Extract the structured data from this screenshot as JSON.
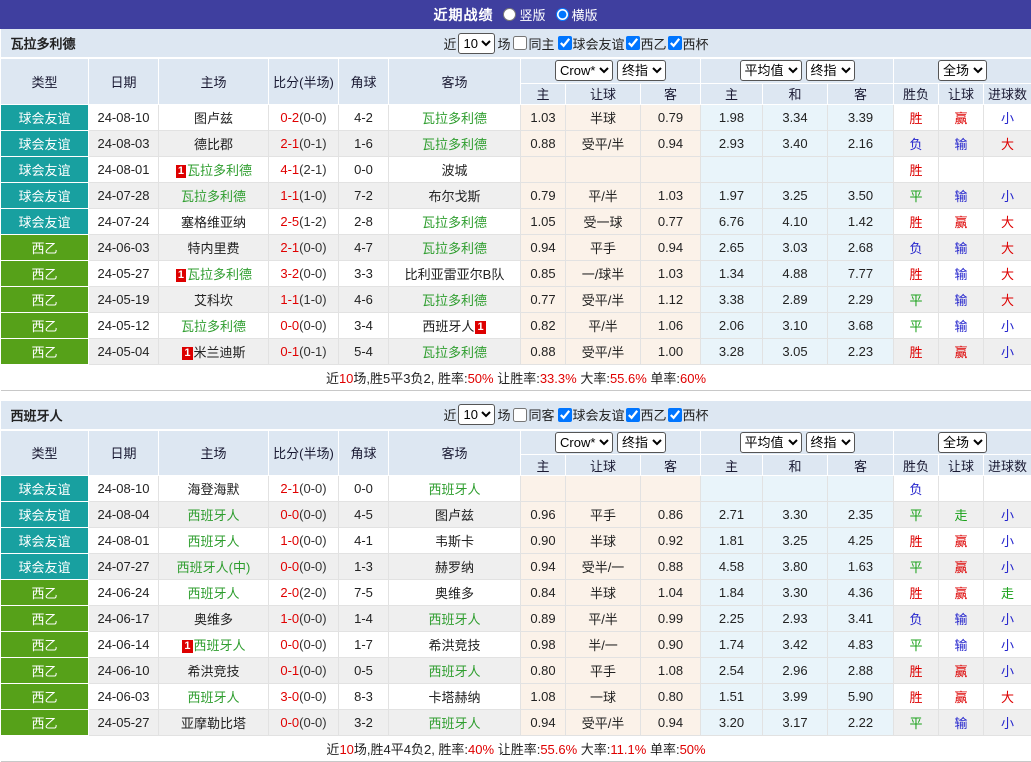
{
  "topbar": {
    "title": "近期战绩",
    "radios": [
      {
        "label": "竖版",
        "selected": false
      },
      {
        "label": "横版",
        "selected": true
      }
    ]
  },
  "colors": {
    "topbar_bg": "#3f3f9f",
    "header_bg": "#dde7f2",
    "friendly_type_bg": "#18a0a0",
    "league_type_bg": "#56a119",
    "team_green": "#2f9e2f",
    "score_red": "#e00000",
    "result_red": "#dd0000",
    "result_green": "#18a018",
    "result_blue": "#2525cd",
    "odds_col_bg": "#fbf2e9",
    "avg_col_bg": "#e9f4fa",
    "row_alt_bg": "#efefef"
  },
  "badge_text": "1",
  "filter_labels": {
    "near": "近",
    "games": "场"
  },
  "header": {
    "cols": [
      "类型",
      "日期",
      "主场",
      "比分(半场)",
      "角球",
      "客场"
    ],
    "groups": [
      "Crow*",
      "终指",
      "平均值",
      "终指",
      "全场"
    ],
    "sub": [
      "主",
      "让球",
      "客",
      "主",
      "和",
      "客",
      "胜负",
      "让球",
      "进球数"
    ]
  },
  "tables": [
    {
      "team": "瓦拉多利德",
      "games_value": "10",
      "same_label": "同主",
      "same_checked": false,
      "filter_options": [
        {
          "label": "球会友谊",
          "checked": true
        },
        {
          "label": "西乙",
          "checked": true
        },
        {
          "label": "西杯",
          "checked": true
        }
      ],
      "rows": [
        {
          "type": "球会友谊",
          "type_style": "friendly",
          "date": "24-08-10",
          "home": "图卢兹",
          "home_green": false,
          "home_badge": false,
          "score": "0-2",
          "half": "(0-0)",
          "corner": "4-2",
          "away": "瓦拉多利德",
          "away_green": true,
          "away_badge": false,
          "odds_home": "1.03",
          "handicap": "半球",
          "odds_away": "0.79",
          "avg_home": "1.98",
          "avg_draw": "3.34",
          "avg_away": "3.39",
          "result": "胜",
          "handicap_result": "赢",
          "goals": "小"
        },
        {
          "type": "球会友谊",
          "type_style": "friendly",
          "date": "24-08-03",
          "home": "德比郡",
          "home_green": false,
          "home_badge": false,
          "score": "2-1",
          "half": "(0-1)",
          "corner": "1-6",
          "away": "瓦拉多利德",
          "away_green": true,
          "away_badge": false,
          "odds_home": "0.88",
          "handicap": "受平/半",
          "odds_away": "0.94",
          "avg_home": "2.93",
          "avg_draw": "3.40",
          "avg_away": "2.16",
          "result": "负",
          "handicap_result": "输",
          "goals": "大"
        },
        {
          "type": "球会友谊",
          "type_style": "friendly",
          "date": "24-08-01",
          "home": "瓦拉多利德",
          "home_green": true,
          "home_badge": true,
          "score": "4-1",
          "half": "(2-1)",
          "corner": "0-0",
          "away": "波城",
          "away_green": false,
          "away_badge": false,
          "odds_home": "",
          "handicap": "",
          "odds_away": "",
          "avg_home": "",
          "avg_draw": "",
          "avg_away": "",
          "result": "胜",
          "handicap_result": "",
          "goals": ""
        },
        {
          "type": "球会友谊",
          "type_style": "friendly",
          "date": "24-07-28",
          "home": "瓦拉多利德",
          "home_green": true,
          "home_badge": false,
          "score": "1-1",
          "half": "(1-0)",
          "corner": "7-2",
          "away": "布尔戈斯",
          "away_green": false,
          "away_badge": false,
          "odds_home": "0.79",
          "handicap": "平/半",
          "odds_away": "1.03",
          "avg_home": "1.97",
          "avg_draw": "3.25",
          "avg_away": "3.50",
          "result": "平",
          "handicap_result": "输",
          "goals": "小"
        },
        {
          "type": "球会友谊",
          "type_style": "friendly",
          "date": "24-07-24",
          "home": "塞格维亚纳",
          "home_green": false,
          "home_badge": false,
          "score": "2-5",
          "half": "(1-2)",
          "corner": "2-8",
          "away": "瓦拉多利德",
          "away_green": true,
          "away_badge": false,
          "odds_home": "1.05",
          "handicap": "受一球",
          "odds_away": "0.77",
          "avg_home": "6.76",
          "avg_draw": "4.10",
          "avg_away": "1.42",
          "result": "胜",
          "handicap_result": "赢",
          "goals": "大"
        },
        {
          "type": "西乙",
          "type_style": "league",
          "date": "24-06-03",
          "home": "特内里费",
          "home_green": false,
          "home_badge": false,
          "score": "2-1",
          "half": "(0-0)",
          "corner": "4-7",
          "away": "瓦拉多利德",
          "away_green": true,
          "away_badge": false,
          "odds_home": "0.94",
          "handicap": "平手",
          "odds_away": "0.94",
          "avg_home": "2.65",
          "avg_draw": "3.03",
          "avg_away": "2.68",
          "result": "负",
          "handicap_result": "输",
          "goals": "大"
        },
        {
          "type": "西乙",
          "type_style": "league",
          "date": "24-05-27",
          "home": "瓦拉多利德",
          "home_green": true,
          "home_badge": true,
          "score": "3-2",
          "half": "(0-0)",
          "corner": "3-3",
          "away": "比利亚雷亚尔B队",
          "away_green": false,
          "away_badge": false,
          "odds_home": "0.85",
          "handicap": "一/球半",
          "odds_away": "1.03",
          "avg_home": "1.34",
          "avg_draw": "4.88",
          "avg_away": "7.77",
          "result": "胜",
          "handicap_result": "输",
          "goals": "大"
        },
        {
          "type": "西乙",
          "type_style": "league",
          "date": "24-05-19",
          "home": "艾科坎",
          "home_green": false,
          "home_badge": false,
          "score": "1-1",
          "half": "(1-0)",
          "corner": "4-6",
          "away": "瓦拉多利德",
          "away_green": true,
          "away_badge": false,
          "odds_home": "0.77",
          "handicap": "受平/半",
          "odds_away": "1.12",
          "avg_home": "3.38",
          "avg_draw": "2.89",
          "avg_away": "2.29",
          "result": "平",
          "handicap_result": "输",
          "goals": "大"
        },
        {
          "type": "西乙",
          "type_style": "league",
          "date": "24-05-12",
          "home": "瓦拉多利德",
          "home_green": true,
          "home_badge": false,
          "score": "0-0",
          "half": "(0-0)",
          "corner": "3-4",
          "away": "西班牙人",
          "away_green": false,
          "away_badge": true,
          "odds_home": "0.82",
          "handicap": "平/半",
          "odds_away": "1.06",
          "avg_home": "2.06",
          "avg_draw": "3.10",
          "avg_away": "3.68",
          "result": "平",
          "handicap_result": "输",
          "goals": "小"
        },
        {
          "type": "西乙",
          "type_style": "league",
          "date": "24-05-04",
          "home": "米兰迪斯",
          "home_green": false,
          "home_badge": true,
          "score": "0-1",
          "half": "(0-1)",
          "corner": "5-4",
          "away": "瓦拉多利德",
          "away_green": true,
          "away_badge": false,
          "odds_home": "0.88",
          "handicap": "受平/半",
          "odds_away": "1.00",
          "avg_home": "3.28",
          "avg_draw": "3.05",
          "avg_away": "2.23",
          "result": "胜",
          "handicap_result": "赢",
          "goals": "小"
        }
      ],
      "summary": [
        {
          "text": "近",
          "red": false
        },
        {
          "text": "10",
          "red": true
        },
        {
          "text": "场,胜5平3负2, 胜率:",
          "red": false
        },
        {
          "text": "50%",
          "red": true
        },
        {
          "text": " 让胜率:",
          "red": false
        },
        {
          "text": "33.3%",
          "red": true
        },
        {
          "text": " 大率:",
          "red": false
        },
        {
          "text": "55.6%",
          "red": true
        },
        {
          "text": " 单率:",
          "red": false
        },
        {
          "text": "60%",
          "red": true
        }
      ]
    },
    {
      "team": "西班牙人",
      "games_value": "10",
      "same_label": "同客",
      "same_checked": false,
      "filter_options": [
        {
          "label": "球会友谊",
          "checked": true
        },
        {
          "label": "西乙",
          "checked": true
        },
        {
          "label": "西杯",
          "checked": true
        }
      ],
      "rows": [
        {
          "type": "球会友谊",
          "type_style": "friendly",
          "date": "24-08-10",
          "home": "海登海默",
          "home_green": false,
          "home_badge": false,
          "score": "2-1",
          "half": "(0-0)",
          "corner": "0-0",
          "away": "西班牙人",
          "away_green": true,
          "away_badge": false,
          "odds_home": "",
          "handicap": "",
          "odds_away": "",
          "avg_home": "",
          "avg_draw": "",
          "avg_away": "",
          "result": "负",
          "handicap_result": "",
          "goals": ""
        },
        {
          "type": "球会友谊",
          "type_style": "friendly",
          "date": "24-08-04",
          "home": "西班牙人",
          "home_green": true,
          "home_badge": false,
          "score": "0-0",
          "half": "(0-0)",
          "corner": "4-5",
          "away": "图卢兹",
          "away_green": false,
          "away_badge": false,
          "odds_home": "0.96",
          "handicap": "平手",
          "odds_away": "0.86",
          "avg_home": "2.71",
          "avg_draw": "3.30",
          "avg_away": "2.35",
          "result": "平",
          "handicap_result": "走",
          "goals": "小"
        },
        {
          "type": "球会友谊",
          "type_style": "friendly",
          "date": "24-08-01",
          "home": "西班牙人",
          "home_green": true,
          "home_badge": false,
          "score": "1-0",
          "half": "(0-0)",
          "corner": "4-1",
          "away": "韦斯卡",
          "away_green": false,
          "away_badge": false,
          "odds_home": "0.90",
          "handicap": "半球",
          "odds_away": "0.92",
          "avg_home": "1.81",
          "avg_draw": "3.25",
          "avg_away": "4.25",
          "result": "胜",
          "handicap_result": "赢",
          "goals": "小"
        },
        {
          "type": "球会友谊",
          "type_style": "friendly",
          "date": "24-07-27",
          "home": "西班牙人(中)",
          "home_green": true,
          "home_badge": false,
          "score": "0-0",
          "half": "(0-0)",
          "corner": "1-3",
          "away": "赫罗纳",
          "away_green": false,
          "away_badge": false,
          "odds_home": "0.94",
          "handicap": "受半/一",
          "odds_away": "0.88",
          "avg_home": "4.58",
          "avg_draw": "3.80",
          "avg_away": "1.63",
          "result": "平",
          "handicap_result": "赢",
          "goals": "小"
        },
        {
          "type": "西乙",
          "type_style": "league",
          "date": "24-06-24",
          "home": "西班牙人",
          "home_green": true,
          "home_badge": false,
          "score": "2-0",
          "half": "(2-0)",
          "corner": "7-5",
          "away": "奥维多",
          "away_green": false,
          "away_badge": false,
          "odds_home": "0.84",
          "handicap": "半球",
          "odds_away": "1.04",
          "avg_home": "1.84",
          "avg_draw": "3.30",
          "avg_away": "4.36",
          "result": "胜",
          "handicap_result": "赢",
          "goals": "走"
        },
        {
          "type": "西乙",
          "type_style": "league",
          "date": "24-06-17",
          "home": "奥维多",
          "home_green": false,
          "home_badge": false,
          "score": "1-0",
          "half": "(0-0)",
          "corner": "1-4",
          "away": "西班牙人",
          "away_green": true,
          "away_badge": false,
          "odds_home": "0.89",
          "handicap": "平/半",
          "odds_away": "0.99",
          "avg_home": "2.25",
          "avg_draw": "2.93",
          "avg_away": "3.41",
          "result": "负",
          "handicap_result": "输",
          "goals": "小"
        },
        {
          "type": "西乙",
          "type_style": "league",
          "date": "24-06-14",
          "home": "西班牙人",
          "home_green": true,
          "home_badge": true,
          "score": "0-0",
          "half": "(0-0)",
          "corner": "1-7",
          "away": "希洪竞技",
          "away_green": false,
          "away_badge": false,
          "odds_home": "0.98",
          "handicap": "半/一",
          "odds_away": "0.90",
          "avg_home": "1.74",
          "avg_draw": "3.42",
          "avg_away": "4.83",
          "result": "平",
          "handicap_result": "输",
          "goals": "小"
        },
        {
          "type": "西乙",
          "type_style": "league",
          "date": "24-06-10",
          "home": "希洪竞技",
          "home_green": false,
          "home_badge": false,
          "score": "0-1",
          "half": "(0-0)",
          "corner": "0-5",
          "away": "西班牙人",
          "away_green": true,
          "away_badge": false,
          "odds_home": "0.80",
          "handicap": "平手",
          "odds_away": "1.08",
          "avg_home": "2.54",
          "avg_draw": "2.96",
          "avg_away": "2.88",
          "result": "胜",
          "handicap_result": "赢",
          "goals": "小"
        },
        {
          "type": "西乙",
          "type_style": "league",
          "date": "24-06-03",
          "home": "西班牙人",
          "home_green": true,
          "home_badge": false,
          "score": "3-0",
          "half": "(0-0)",
          "corner": "8-3",
          "away": "卡塔赫纳",
          "away_green": false,
          "away_badge": false,
          "odds_home": "1.08",
          "handicap": "一球",
          "odds_away": "0.80",
          "avg_home": "1.51",
          "avg_draw": "3.99",
          "avg_away": "5.90",
          "result": "胜",
          "handicap_result": "赢",
          "goals": "大"
        },
        {
          "type": "西乙",
          "type_style": "league",
          "date": "24-05-27",
          "home": "亚摩勒比塔",
          "home_green": false,
          "home_badge": false,
          "score": "0-0",
          "half": "(0-0)",
          "corner": "3-2",
          "away": "西班牙人",
          "away_green": true,
          "away_badge": false,
          "odds_home": "0.94",
          "handicap": "受平/半",
          "odds_away": "0.94",
          "avg_home": "3.20",
          "avg_draw": "3.17",
          "avg_away": "2.22",
          "result": "平",
          "handicap_result": "输",
          "goals": "小"
        }
      ],
      "summary": [
        {
          "text": "近",
          "red": false
        },
        {
          "text": "10",
          "red": true
        },
        {
          "text": "场,胜4平4负2, 胜率:",
          "red": false
        },
        {
          "text": "40%",
          "red": true
        },
        {
          "text": " 让胜率:",
          "red": false
        },
        {
          "text": "55.6%",
          "red": true
        },
        {
          "text": " 大率:",
          "red": false
        },
        {
          "text": "11.1%",
          "red": true
        },
        {
          "text": " 单率:",
          "red": false
        },
        {
          "text": "50%",
          "red": true
        }
      ]
    }
  ]
}
